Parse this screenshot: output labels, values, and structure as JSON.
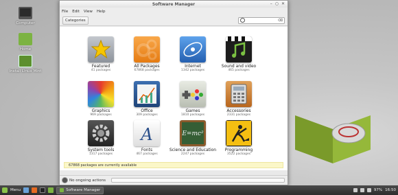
{
  "desktop": {
    "icons": [
      {
        "label": "Computer"
      },
      {
        "label": "Home"
      },
      {
        "label": "Install Linux Mint"
      }
    ]
  },
  "window": {
    "title": "Software Manager",
    "controls": [
      "–",
      "○",
      "✕"
    ],
    "menu": [
      "File",
      "Edit",
      "View",
      "Help"
    ],
    "categories_button": "Categories",
    "search": {
      "value": "",
      "placeholder": ""
    },
    "categories": [
      {
        "name": "Featured",
        "count": "41 packages",
        "icon": "star-icon",
        "color": "#9aa0a8"
      },
      {
        "name": "All Packages",
        "count": "67868 packages",
        "icon": "gears-icon",
        "color": "#f28c1e"
      },
      {
        "name": "Internet",
        "count": "1342 packages",
        "icon": "globe-icon",
        "color": "#3b7fd2"
      },
      {
        "name": "Sound and video",
        "count": "465 packages",
        "icon": "music-note-icon",
        "color": "#222222"
      },
      {
        "name": "Graphics",
        "count": "969 packages",
        "icon": "color-wheel-icon",
        "color": "#e04a2a"
      },
      {
        "name": "Office",
        "count": "309 packages",
        "icon": "chart-icon",
        "color": "#2e5c9a"
      },
      {
        "name": "Games",
        "count": "1810 packages",
        "icon": "gamepad-icon",
        "color": "#cfd4c8"
      },
      {
        "name": "Accessories",
        "count": "2331 packages",
        "icon": "calculator-icon",
        "color": "#c97b2f"
      },
      {
        "name": "System tools",
        "count": "1317 packages",
        "icon": "cogwheel-icon",
        "color": "#3a3a3a"
      },
      {
        "name": "Fonts",
        "count": "467 packages",
        "icon": "letter-a-icon",
        "color": "#f3f3f3"
      },
      {
        "name": "Science and Education",
        "count": "2247 packages",
        "icon": "chalkboard-icon",
        "color": "#3e6a3e"
      },
      {
        "name": "Programming",
        "count": "3522 packages",
        "icon": "construction-icon",
        "color": "#f2b90f"
      }
    ],
    "status_message": "67868 packages are currently available",
    "ongoing_actions": "No ongoing actions"
  },
  "taskbar": {
    "menu_label": "Menu",
    "active_task": "Software Manager",
    "battery": "97%",
    "clock": "16:50"
  }
}
